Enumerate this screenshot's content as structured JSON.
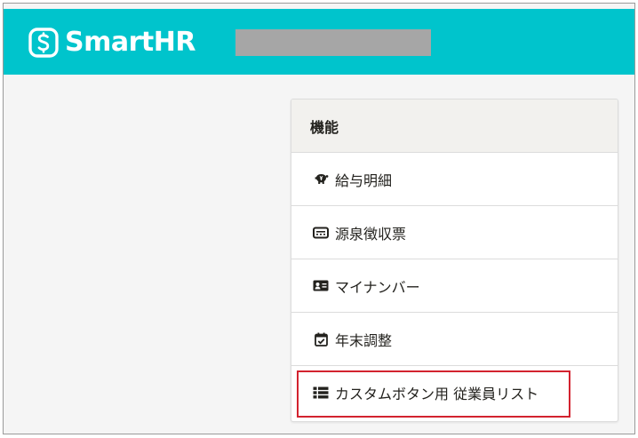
{
  "app": {
    "logo_text": "SmartHR",
    "brand_color": "#00c4cc",
    "redacted_text": ""
  },
  "panel": {
    "title": "機能",
    "items": [
      {
        "icon": "piggy-bank-icon",
        "label": "給与明細"
      },
      {
        "icon": "receipt-icon",
        "label": "源泉徴収票"
      },
      {
        "icon": "id-card-icon",
        "label": "マイナンバー"
      },
      {
        "icon": "calendar-check-icon",
        "label": "年末調整"
      },
      {
        "icon": "list-icon",
        "label": "カスタムボタン用 従業員リスト"
      }
    ]
  },
  "annotation": {
    "highlight_color": "#d3232f"
  }
}
